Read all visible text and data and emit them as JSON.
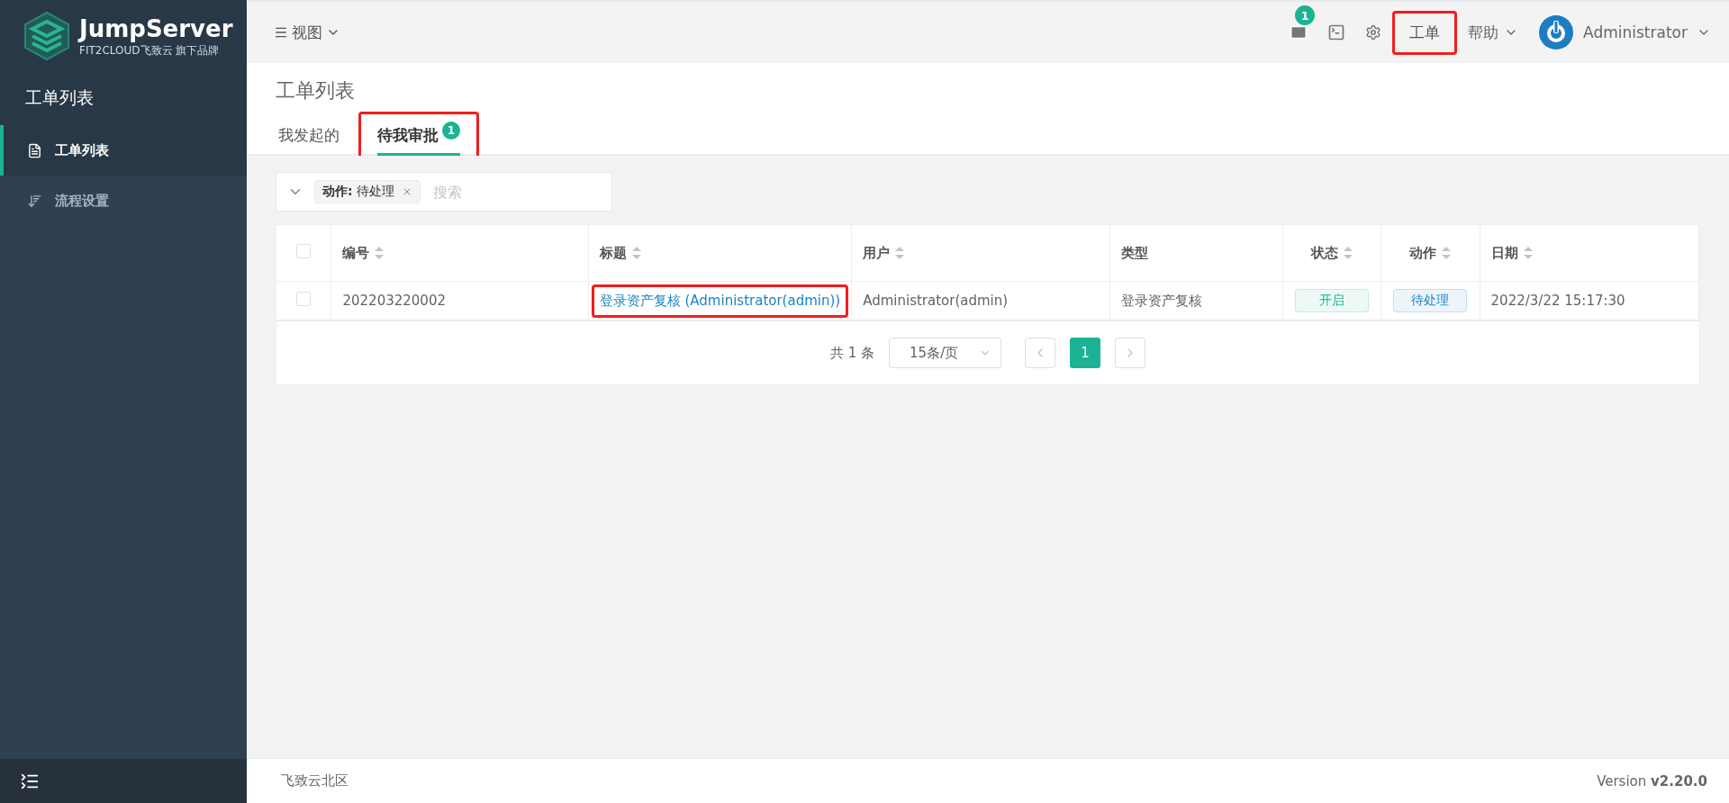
{
  "logo": {
    "name": "JumpServer",
    "tagline": "FIT2CLOUD飞致云 旗下品牌"
  },
  "sidebar": {
    "title": "工单列表",
    "items": [
      {
        "label": "工单列表",
        "kind": "doc",
        "selected": true
      },
      {
        "label": "流程设置",
        "kind": "sort",
        "selected": false
      }
    ]
  },
  "topbar": {
    "view_menu": "视图",
    "mail_badge": "1",
    "ticket_link": {
      "label": "工单",
      "highlighted": true
    },
    "help_menu": "帮助",
    "user": "Administrator"
  },
  "page": {
    "title": "工单列表",
    "tabs": [
      {
        "label": "我发起的",
        "selected": false,
        "highlighted": false
      },
      {
        "label": "待我审批",
        "selected": true,
        "badge": "1",
        "highlighted": true
      }
    ]
  },
  "filter": {
    "tag_key": "动作:",
    "tag_value": "待处理",
    "placeholder": "搜索"
  },
  "table": {
    "all_checked": false,
    "columns": [
      {
        "label": "编号",
        "sortable": true
      },
      {
        "label": "标题",
        "sortable": true
      },
      {
        "label": "用户",
        "sortable": true
      },
      {
        "label": "类型",
        "sortable": false
      },
      {
        "label": "状态",
        "sortable": true
      },
      {
        "label": "动作",
        "sortable": true
      },
      {
        "label": "日期",
        "sortable": true
      }
    ],
    "rows": [
      {
        "checked": false,
        "cells": [
          {
            "kind": "text",
            "text": "202203220002"
          },
          {
            "kind": "link",
            "text": "登录资产复核 (Administrator(admin))",
            "highlighted": true
          },
          {
            "kind": "text",
            "text": "Administrator(admin)"
          },
          {
            "kind": "text",
            "text": "登录资产复核"
          },
          {
            "kind": "tag",
            "text": "开启",
            "color": "#1ab394"
          },
          {
            "kind": "tag",
            "text": "待处理",
            "color": "#1c84c6"
          },
          {
            "kind": "text",
            "text": "2022/3/22 15:17:30"
          }
        ]
      }
    ]
  },
  "pagination": {
    "total": "共 1 条",
    "page_size": "15条/页",
    "pages": [
      {
        "label": "1",
        "selected": true
      }
    ]
  },
  "footer": {
    "left": "飞致云北区",
    "version": "Version **v2.20.0**"
  }
}
